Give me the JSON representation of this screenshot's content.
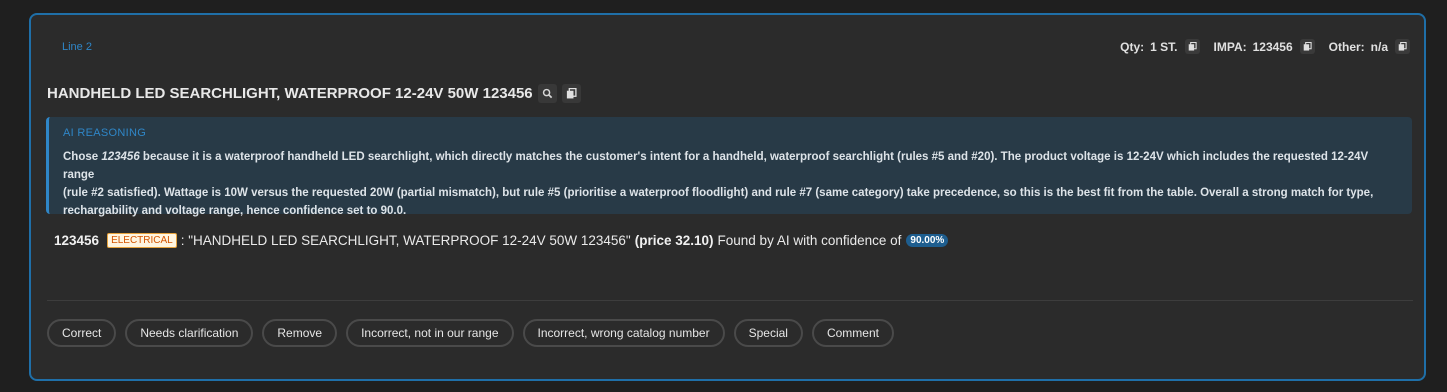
{
  "card": {
    "line_label": "Line 2",
    "meta": {
      "qty_key": "Qty:",
      "qty_value": "1 ST.",
      "impa_key": "IMPA:",
      "impa_value": "123456",
      "other_key": "Other:",
      "other_value": "n/a"
    },
    "title": "HANDHELD LED SEARCHLIGHT, WATERPROOF 12-24V 50W 123456"
  },
  "reasoning": {
    "heading": "AI REASONING",
    "line1_prefix": "Chose ",
    "line1_code": "123456",
    "line1_rest": " because it is a waterproof handheld LED searchlight, which directly matches the customer's intent for a handheld, waterproof searchlight (rules #5 and #20). The product voltage is 12-24V which includes the requested 12-24V range",
    "line2": "(rule #2 satisfied). Wattage is 10W versus the requested 20W (partial mismatch), but rule #5 (prioritise a waterproof floodlight) and rule #7 (same category) take precedence, so this is the best fit from the table. Overall a strong match for type,",
    "line3": "rechargability and voltage range, hence confidence set to 90.0."
  },
  "match": {
    "code": "123456",
    "category": "ELECTRICAL",
    "description": ": \"HANDHELD LED SEARCHLIGHT, WATERPROOF 12-24V 50W 123456\"",
    "price": "(price 32.10)",
    "found_text": "Found by AI with confidence of",
    "confidence": "90.00%"
  },
  "actions": [
    "Correct",
    "Needs clarification",
    "Remove",
    "Incorrect, not in our range",
    "Incorrect, wrong catalog number",
    "Special",
    "Comment"
  ],
  "colors": {
    "accent": "#2f86c7",
    "card_border": "#1f6fa8",
    "reason_bg": "#283a47",
    "tag_text": "#d35400",
    "confidence_bg": "#1e5e8f"
  },
  "icons": [
    "copy-icon",
    "search-icon"
  ]
}
